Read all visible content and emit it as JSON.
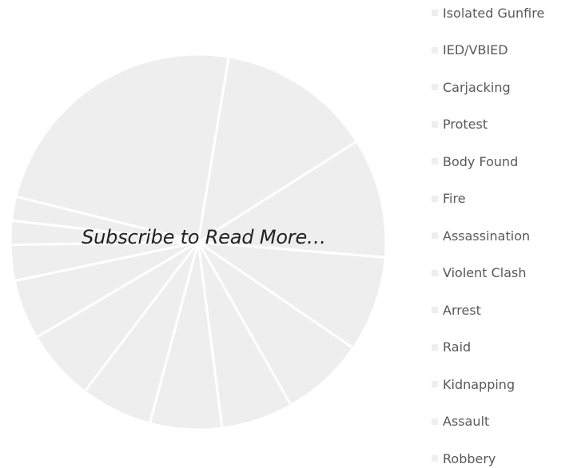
{
  "overlay": {
    "text": "Subscribe to Read More…"
  },
  "colors": {
    "slice_fill": "#eeeeee",
    "slice_border": "#ffffff",
    "legend_swatch": "#eeeeee",
    "legend_text": "#595959",
    "overlay_text": "#222222"
  },
  "chart_data": {
    "type": "pie",
    "title": "",
    "legend_position": "right",
    "series": [
      {
        "categories": [
          "Isolated Gunfire",
          "IED/VBIED",
          "Carjacking",
          "Protest",
          "Body Found",
          "Fire",
          "Assassination",
          "Violent Clash",
          "Arrest",
          "Raid",
          "Kidnapping",
          "Assault",
          "Robbery"
        ],
        "values": [
          23,
          13,
          10,
          8,
          7,
          6,
          6,
          6,
          6,
          5,
          3,
          2,
          2
        ]
      }
    ]
  }
}
